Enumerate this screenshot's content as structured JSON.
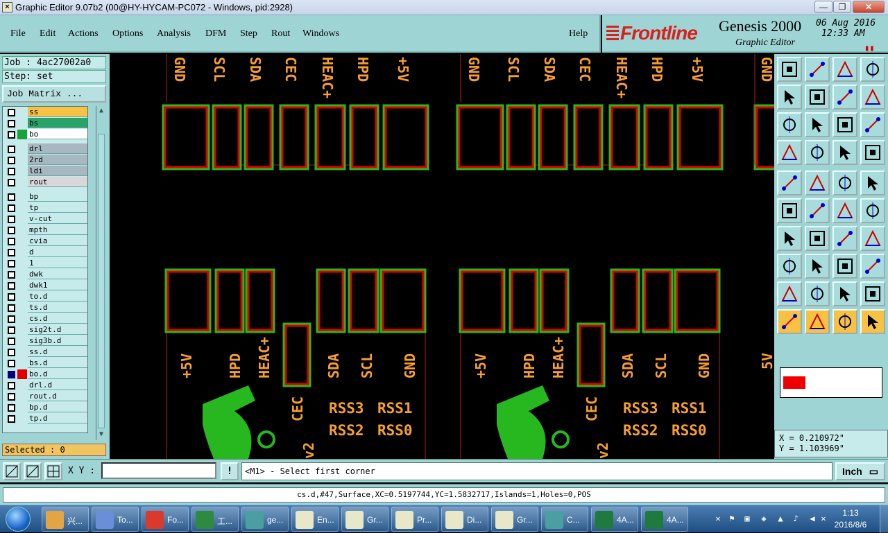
{
  "window": {
    "title": "Graphic Editor 9.07b2 (00@HY-HYCAM-PC072 - Windows, pid:2928)",
    "min": "—",
    "max": "❐",
    "close": "✕"
  },
  "menu": [
    {
      "label": "File",
      "u": "F"
    },
    {
      "label": "Edit",
      "u": "E"
    },
    {
      "label": "Actions",
      "u": "A"
    },
    {
      "label": "Options",
      "u": "O"
    },
    {
      "label": "Analysis",
      "u": "n"
    },
    {
      "label": "DFM",
      "u": "D"
    },
    {
      "label": "Step",
      "u": "S"
    },
    {
      "label": "Rout",
      "u": "R"
    },
    {
      "label": "Windows",
      "u": "W"
    },
    {
      "label": "Help",
      "u": "H"
    }
  ],
  "logo": {
    "brand": "Frontline",
    "product": "Genesis 2000",
    "sub": "Graphic Editor",
    "date": "06 Aug 2016",
    "time": "12:33 AM",
    "indicator": "▮▮"
  },
  "job": {
    "job_label": "Job : 4ac27002a0",
    "step_label": "Step: set",
    "matrix": "Job Matrix ...",
    "selected": "Selected : 0"
  },
  "layers": [
    {
      "name": "ss",
      "bg": "#f7c244",
      "sw": ""
    },
    {
      "name": "bs",
      "bg": "#2aa36b",
      "sw": ""
    },
    {
      "name": "bo",
      "bg": "#ffffff",
      "sw": "#1aa33b"
    },
    {
      "name": "drl",
      "bg": "#a8b8c0",
      "sw": "",
      "gap": true
    },
    {
      "name": "2rd",
      "bg": "#a8b8c0",
      "sw": ""
    },
    {
      "name": "ldi",
      "bg": "#a8b8c0",
      "sw": ""
    },
    {
      "name": "rout",
      "bg": "#d8d8d8",
      "sw": ""
    },
    {
      "name": "bp",
      "bg": "#c7eaea",
      "sw": "",
      "gap": true
    },
    {
      "name": "tp",
      "bg": "#c7eaea",
      "sw": ""
    },
    {
      "name": "v-cut",
      "bg": "#c7eaea",
      "sw": ""
    },
    {
      "name": "mpth",
      "bg": "#c7eaea",
      "sw": ""
    },
    {
      "name": "cvia",
      "bg": "#c7eaea",
      "sw": ""
    },
    {
      "name": "d",
      "bg": "#c7eaea",
      "sw": ""
    },
    {
      "name": "1",
      "bg": "#c7eaea",
      "sw": ""
    },
    {
      "name": "dwk",
      "bg": "#c7eaea",
      "sw": ""
    },
    {
      "name": "dwk1",
      "bg": "#c7eaea",
      "sw": ""
    },
    {
      "name": "to.d",
      "bg": "#c7eaea",
      "sw": ""
    },
    {
      "name": "ts.d",
      "bg": "#c7eaea",
      "sw": ""
    },
    {
      "name": "cs.d",
      "bg": "#c7eaea",
      "sw": ""
    },
    {
      "name": "sig2t.d",
      "bg": "#c7eaea",
      "sw": ""
    },
    {
      "name": "sig3b.d",
      "bg": "#c7eaea",
      "sw": ""
    },
    {
      "name": "ss.d",
      "bg": "#c7eaea",
      "sw": ""
    },
    {
      "name": "bs.d",
      "bg": "#c7eaea",
      "sw": ""
    },
    {
      "name": "bo.d",
      "bg": "#c7eaea",
      "sw": "#e00000",
      "active": true
    },
    {
      "name": "drl.d",
      "bg": "#c7eaea",
      "sw": ""
    },
    {
      "name": "rout.d",
      "bg": "#c7eaea",
      "sw": ""
    },
    {
      "name": "bp.d",
      "bg": "#c7eaea",
      "sw": ""
    },
    {
      "name": "tp.d",
      "bg": "#c7eaea",
      "sw": ""
    }
  ],
  "canvas": {
    "top_labels": [
      "GND",
      "SCL",
      "SDA",
      "CEC",
      "HEAC+",
      "HPD",
      "+5V"
    ],
    "bottom_labels": [
      "+5V",
      "HPD",
      "HEAC+",
      "SDA",
      "SCL",
      "GND"
    ],
    "cec_label": "CEC",
    "rss_labels": [
      "RSS3",
      "RSS1",
      "RSS2",
      "RSS0"
    ],
    "v2_label": "v2",
    "edge_label_top": "GND",
    "edge_label_bottom": "5V",
    "colors": {
      "pad": "#e00000",
      "outline": "#27b81f",
      "text": "#f7a030",
      "trace": "#b02020"
    }
  },
  "tools": [
    "open-step-icon",
    "save-icon",
    "home-icon",
    "window-icon",
    "pan-left-icon",
    "pan-right-icon",
    "swap-icon",
    "snap-icon",
    "zoom-fit-icon",
    "zoom-center-icon",
    "scale-1-2-icon",
    "help-icon",
    "measure-icon",
    "target-icon",
    "connect-icon",
    "connect-alt-icon",
    "pad-icon",
    "clip-icon",
    "ruler-icon",
    "dot-icon",
    "net-icon",
    "cross-icon",
    "arrow-connect-icon",
    "arrow-connect-alt-icon",
    "line-angle-icon",
    "line-icon",
    "rotate-icon",
    "mirror-icon",
    "snap-point-icon",
    "line-mid-icon",
    "resize-icon",
    "shape-icon",
    "triangle-icon",
    "triangle-a-icon",
    "arch-icon",
    "arch-alt-icon",
    "pointer-icon",
    "pointer-alt-icon",
    "pointer-circle-icon",
    "pointer-net-icon"
  ],
  "coords": {
    "x": "X = 0.210972\"",
    "y": "Y = 1.103969\""
  },
  "cmd": {
    "xy_label": "X Y :",
    "xy_value": "",
    "excl": "!",
    "prompt": "<M1> - Select first corner",
    "unit": "Inch"
  },
  "status": "cs.d,#47,Surface,XC=0.5197744,YC=1.5832717,Islands=1,Holes=0,POS",
  "taskbar": [
    {
      "label": "兴...",
      "color": "#e3a443"
    },
    {
      "label": "To...",
      "color": "#6a8fd8"
    },
    {
      "label": "Fo...",
      "color": "#d93a2b"
    },
    {
      "label": "工...",
      "color": "#2e8a3e"
    },
    {
      "label": "ge...",
      "color": "#4aa0a0"
    },
    {
      "label": "En...",
      "color": "#e8e8c8"
    },
    {
      "label": "Gr...",
      "color": "#e8e8c8"
    },
    {
      "label": "Pr...",
      "color": "#e8e8c8"
    },
    {
      "label": "Di...",
      "color": "#e8e8c8"
    },
    {
      "label": "Gr...",
      "color": "#e8e8c8"
    },
    {
      "label": "C...",
      "color": "#4aa0a0"
    },
    {
      "label": "4A...",
      "color": "#1f7a3e"
    },
    {
      "label": "4A...",
      "color": "#1f7a3e"
    }
  ],
  "clock": {
    "time": "1:13",
    "date": "2016/8/6"
  }
}
